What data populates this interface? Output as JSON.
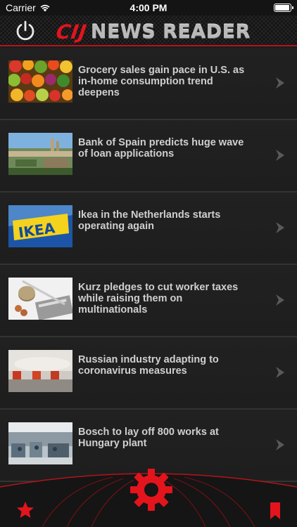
{
  "status_bar": {
    "carrier": "Carrier",
    "time": "4:00 PM",
    "battery_level": 1.0
  },
  "header": {
    "logo_mark": "CIJ",
    "logo_text": "NEWS READER",
    "power_icon": "power-icon"
  },
  "articles": [
    {
      "headline": "Grocery sales gain pace in U.S. as in-home consumption trend deepens",
      "thumb": "vegetables"
    },
    {
      "headline": "Bank of Spain predicts huge wave of loan applications",
      "thumb": "park-guell"
    },
    {
      "headline": "Ikea in the Netherlands starts operating again",
      "thumb": "ikea-sign"
    },
    {
      "headline": "Kurz pledges to cut worker taxes while raising them on multinationals",
      "thumb": "coins-calculator"
    },
    {
      "headline": "Russian industry adapting to coronavirus measures",
      "thumb": "trucks-spraying"
    },
    {
      "headline": "Bosch to lay off 800 works at Hungary plant",
      "thumb": "factory-floor"
    }
  ],
  "tab_bar": {
    "left_icon": "star-icon",
    "center_icon": "gear-icon",
    "right_icon": "bookmark-icon"
  },
  "colors": {
    "accent_red": "#e3141c",
    "background": "#1c1c1c",
    "headline_text": "#cfcfcf",
    "separator": "#343434"
  }
}
